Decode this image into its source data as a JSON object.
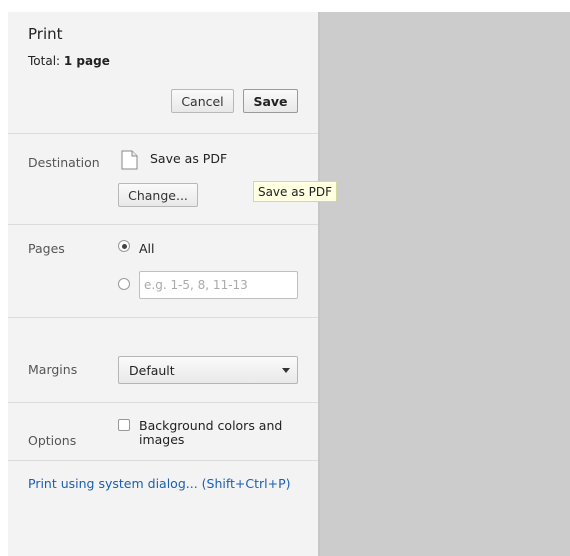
{
  "header": {
    "title": "Print",
    "total_label": "Total:",
    "total_value": "1 page"
  },
  "buttons": {
    "cancel": "Cancel",
    "save": "Save",
    "change": "Change..."
  },
  "destination": {
    "label": "Destination",
    "name": "Save as PDF",
    "icon": "document-icon",
    "tooltip": "Save as PDF"
  },
  "pages": {
    "label": "Pages",
    "all_label": "All",
    "selected": "All",
    "custom_placeholder": "e.g. 1-5, 8, 11-13",
    "custom_value": ""
  },
  "margins": {
    "label": "Margins",
    "selected": "Default"
  },
  "options": {
    "label": "Options",
    "background_label": "Background colors and images",
    "background_checked": false
  },
  "system_dialog": {
    "link": "Print using system dialog... (Shift+Ctrl+P)"
  }
}
